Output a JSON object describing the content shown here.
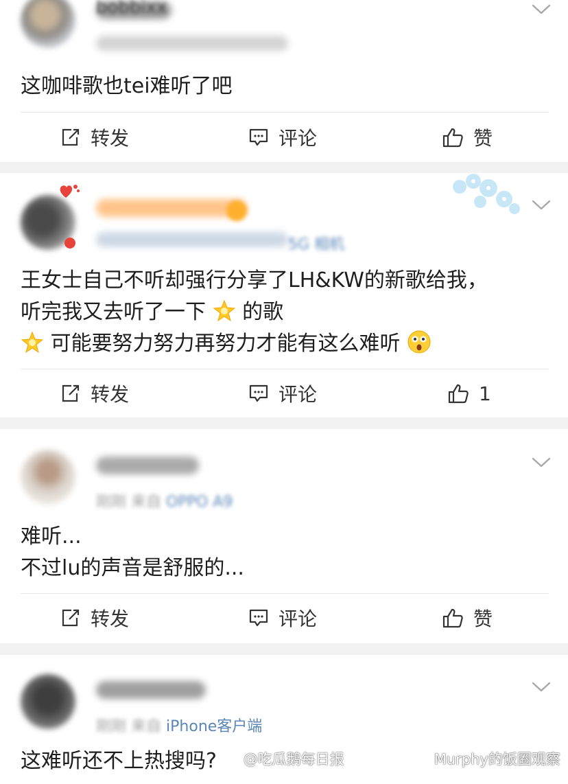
{
  "posts": [
    {
      "username": "bobbixx",
      "text_lines": [
        "这咖啡歌也tei难听了吧"
      ],
      "actions": {
        "repost": "转发",
        "comment": "评论",
        "like": "赞"
      }
    },
    {
      "meta_source": "5G 相机",
      "text_line1": "王女士自己不听却强行分享了LH&KW的新歌给我，",
      "text_line2_a": "听完我又去听了一下",
      "text_line2_b": "的歌",
      "text_line3": "可能要努力努力再努力才能有这么难听",
      "actions": {
        "repost": "转发",
        "comment": "评论",
        "like": "1"
      }
    },
    {
      "meta_time": "刚刚",
      "meta_from": "来自",
      "meta_source": "OPPO A9",
      "text_lines": [
        "难听...",
        "不过lu的声音是舒服的..."
      ],
      "actions": {
        "repost": "转发",
        "comment": "评论",
        "like": "赞"
      }
    },
    {
      "meta_time": "刚刚",
      "meta_from": "来自",
      "meta_source": "iPhone客户端",
      "text_lines": [
        "这难听还不上热搜吗?"
      ]
    }
  ],
  "watermarks": {
    "weibo": "@吃瓜鹅每日报",
    "wechat": "Murphy的饭圈观察"
  },
  "icons": {
    "repost": "repost-icon",
    "comment": "comment-icon",
    "like": "thumbs-up-icon",
    "menu": "chevron-down-icon",
    "star": "star-emoji",
    "face": "shocked-face-emoji"
  },
  "colors": {
    "source_link": "#5b86b8",
    "meta_gray": "#a0a0a0",
    "separator": "#f2f2f2"
  }
}
